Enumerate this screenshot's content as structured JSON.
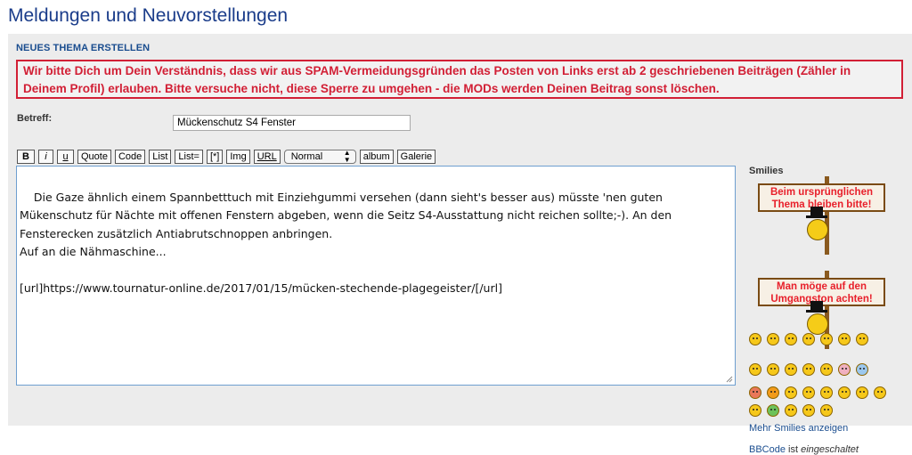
{
  "page": {
    "title": "Meldungen und Neuvorstellungen",
    "section_heading": "NEUES THEMA ERSTELLEN",
    "warning": "Wir bitte Dich um Dein Verständnis, dass wir aus SPAM-Vermeidungsgründen das Posten von Links erst ab 2 geschriebenen Beiträgen (Zähler in Deinem Profil) erlauben. Bitte versuche nicht, diese Sperre zu umgehen - die MODs werden Deinen Beitrag sonst löschen."
  },
  "form": {
    "subject_label": "Betreff:",
    "subject_value": "Mückenschutz S4 Fenster",
    "message": "Die Gaze ähnlich einem Spannbetttuch mit Einziehgummi versehen (dann sieht's besser aus) müsste 'nen guten Mükenschutz für Nächte mit offenen Fenstern abgeben, wenn die Seitz S4-Ausstattung nicht reichen sollte;-). An den Fensterecken zusätzlich Antiabrutschnoppen anbringen.\nAuf an die Nähmaschine...\n\n[url]https://www.tournatur-online.de/2017/01/15/mücken-stechende-plagegeister/[/url]"
  },
  "toolbar": {
    "bold": "B",
    "italic": "i",
    "underline": "u",
    "quote": "Quote",
    "code": "Code",
    "list": "List",
    "list_eq": "List=",
    "list_item": "[*]",
    "img": "Img",
    "url": "URL",
    "font_size": "Normal",
    "album": "album",
    "galerie": "Galerie"
  },
  "smilies": {
    "title": "Smilies",
    "sign1": "Beim ursprünglichen Thema bleiben bitte!",
    "sign2": "Man möge auf den Umgangston achten!",
    "more": "Mehr Smilies anzeigen"
  },
  "status": {
    "bbcode_link": "BBCode",
    "bbcode_text": "ist",
    "bbcode_state": "eingeschaltet"
  }
}
